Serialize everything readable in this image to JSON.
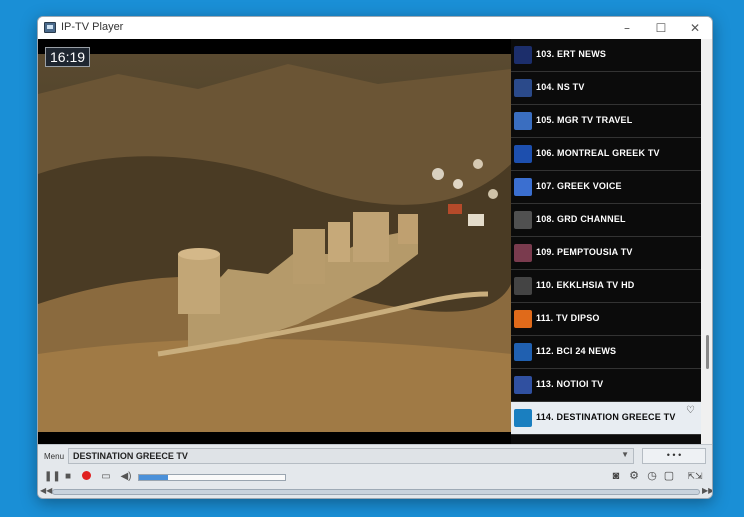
{
  "window": {
    "title": "IP-TV Player",
    "minimize": "–",
    "maximize": "☐",
    "close": "✕"
  },
  "video": {
    "clock": "16:19"
  },
  "channels": [
    {
      "label": "103. ERT NEWS",
      "logo_color": "#1c2e6b"
    },
    {
      "label": "104. NS TV",
      "logo_color": "#2b4a8a"
    },
    {
      "label": "105. MGR TV TRAVEL",
      "logo_color": "#3a6ec0"
    },
    {
      "label": "106. MONTREAL GREEK TV",
      "logo_color": "#1d4fae"
    },
    {
      "label": "107. GREEK VOICE",
      "logo_color": "#3b6fd0"
    },
    {
      "label": "108. GRD CHANNEL",
      "logo_color": "#505050"
    },
    {
      "label": "109. PEMPTOUSIA TV",
      "logo_color": "#7a3b4e"
    },
    {
      "label": "110. EKKLHSIA TV HD",
      "logo_color": "#444444"
    },
    {
      "label": "111. TV DIPSO",
      "logo_color": "#e06a1a"
    },
    {
      "label": "112. BCI 24 NEWS",
      "logo_color": "#2060b0"
    },
    {
      "label": "113. NOTIOI TV",
      "logo_color": "#3050a0"
    },
    {
      "label": "114. DESTINATION GREECE TV",
      "logo_color": "#1a7fc0",
      "selected": true
    }
  ],
  "controls": {
    "menu_label": "Menu",
    "selected_channel": "DESTINATION GREECE TV",
    "dropdown_arrow": "▼",
    "more_label": "• • •",
    "volume_fraction": 0.2
  }
}
